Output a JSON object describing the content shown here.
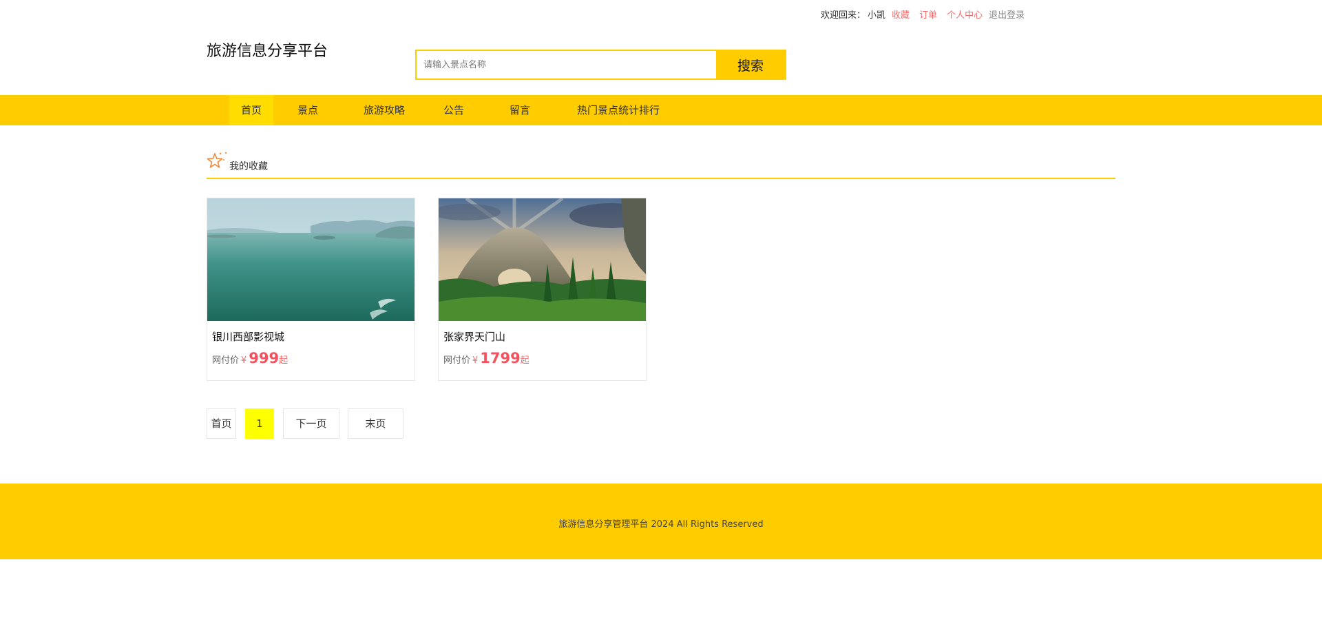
{
  "topbar": {
    "welcome": "欢迎回来：",
    "username": "小凯",
    "favorites": "收藏",
    "orders": "订单",
    "profile": "个人中心",
    "logout": "退出登录"
  },
  "header": {
    "title": "旅游信息分享平台"
  },
  "search": {
    "placeholder": "请输入景点名称",
    "value": "",
    "button": "搜索"
  },
  "nav": {
    "items": [
      {
        "label": "首页",
        "active": true
      },
      {
        "label": "景点",
        "active": false
      },
      {
        "label": "旅游攻略",
        "active": false
      },
      {
        "label": "公告",
        "active": false
      },
      {
        "label": "留言",
        "active": false
      },
      {
        "label": "热门景点统计排行",
        "active": false
      }
    ]
  },
  "section": {
    "title": "我的收藏",
    "icon": "star-icon"
  },
  "cards": [
    {
      "name": "银川西部影视城",
      "price_label": "网付价",
      "currency": "¥",
      "price": "999",
      "suffix": "起",
      "image": "lake-landscape-image"
    },
    {
      "name": "张家界天门山",
      "price_label": "网付价",
      "currency": "¥",
      "price": "1799",
      "suffix": "起",
      "image": "mountain-arch-image"
    }
  ],
  "pagination": {
    "first": "首页",
    "current": "1",
    "next": "下一页",
    "last": "末页"
  },
  "footer": {
    "text": "旅游信息分享管理平台 2024 All Rights Reserved"
  },
  "colors": {
    "accent": "#ffcc00",
    "nav_active": "#ffdd00",
    "price": "#f5515f",
    "link_pink": "#f56c6c",
    "page_current": "#ffff00"
  }
}
